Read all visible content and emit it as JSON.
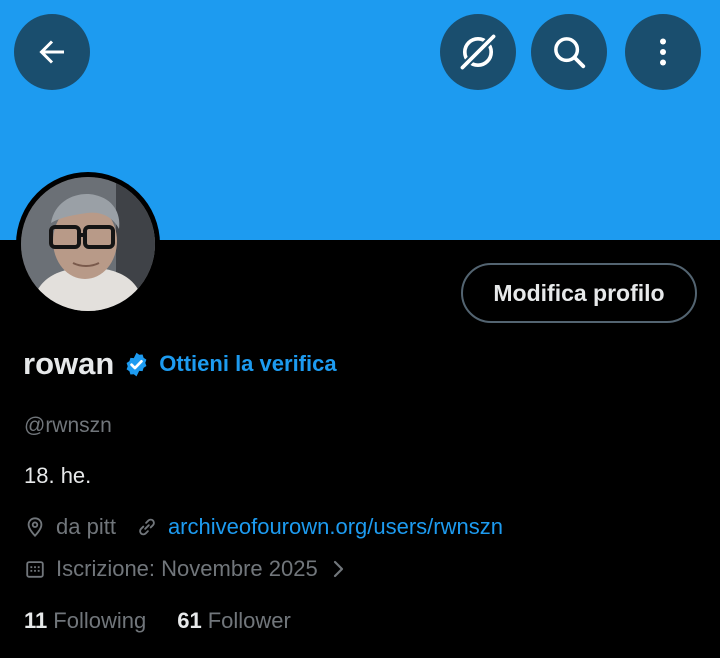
{
  "header": {
    "back_icon": "arrow-left-icon",
    "grok_icon": "grok-icon",
    "search_icon": "search-icon",
    "more_icon": "more-vertical-icon",
    "banner_color": "#1d9bf0",
    "button_bg": "#1a4e6e"
  },
  "profile": {
    "edit_label": "Modifica profilo",
    "display_name": "rowan",
    "verified_icon": "verified-badge-icon",
    "get_verified_label": "Ottieni la verifica",
    "handle": "@rwnszn",
    "bio": "18. he.",
    "location": "da pitt",
    "website": "archiveofourown.org/users/rwnszn",
    "joined": "Iscrizione: Novembre 2025",
    "following_count": "11",
    "following_label": "Following",
    "followers_count": "61",
    "followers_label": "Follower"
  },
  "colors": {
    "accent": "#1d9bf0",
    "secondary_text": "#71767b",
    "primary_text": "#e7e9ea",
    "background": "#000000"
  }
}
